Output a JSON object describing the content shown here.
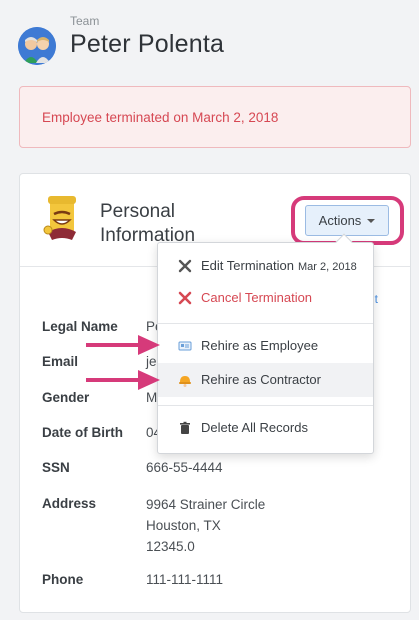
{
  "header": {
    "team_label": "Team",
    "person_name": "Peter Polenta"
  },
  "alert": {
    "message": "Employee terminated on March 2, 2018",
    "color": "#d64853"
  },
  "section": {
    "title": "Personal Information",
    "actions_label": "Actions",
    "edit_link": "it"
  },
  "fields": [
    {
      "label": "Legal Name",
      "value": "Pe"
    },
    {
      "label": "Email",
      "value": "je"
    },
    {
      "label": "Gender",
      "value": "M"
    },
    {
      "label": "Date of Birth",
      "value": "04"
    },
    {
      "label": "SSN",
      "value": "666-55-4444"
    },
    {
      "label": "Address",
      "lines": [
        "9964 Strainer Circle",
        "Houston, TX",
        "12345.0"
      ]
    },
    {
      "label": "Phone",
      "value": "111-111-1111"
    }
  ],
  "menu": {
    "items": [
      {
        "label": "Edit Termination",
        "date": "Mar 2, 2018",
        "icon": "wrench-icon"
      },
      {
        "label": "Cancel Termination",
        "icon": "x-icon",
        "color": "#d64853"
      },
      {
        "label": "Rehire as Employee",
        "icon": "id-card-icon"
      },
      {
        "label": "Rehire as Contractor",
        "icon": "hard-hat-icon"
      },
      {
        "label": "Delete All Records",
        "icon": "trash-icon"
      }
    ]
  },
  "colors": {
    "accent_pink": "#d63a7a",
    "button_bg": "#e6f0fb",
    "link": "#4a90e2"
  }
}
